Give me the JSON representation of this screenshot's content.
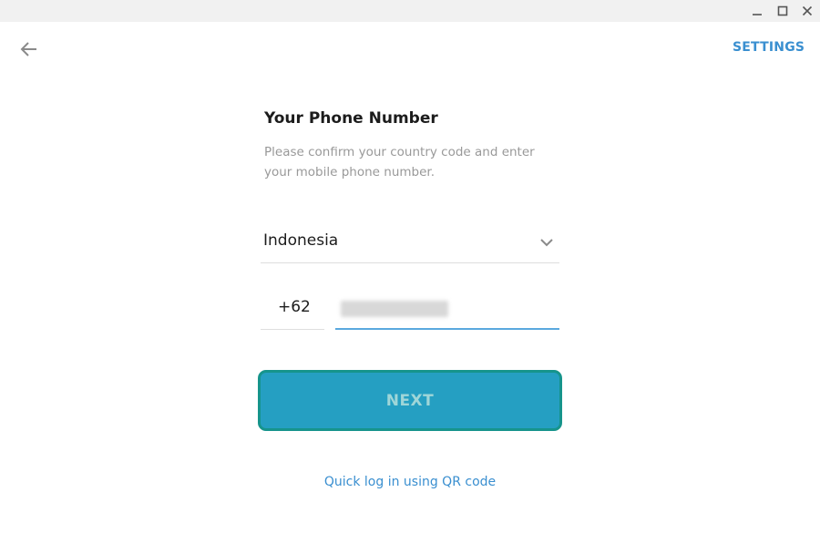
{
  "window": {
    "minimize_icon": "minimize-icon",
    "maximize_icon": "maximize-icon",
    "close_icon": "close-icon"
  },
  "header": {
    "back_icon": "arrow-left-icon",
    "settings_label": "SETTINGS"
  },
  "login": {
    "title": "Your Phone Number",
    "subtitle": "Please confirm your country code and enter your mobile phone number.",
    "country": "Indonesia",
    "country_code": "+62",
    "phone_value_redacted": true,
    "next_label": "NEXT",
    "qr_link_label": "Quick log in using QR code"
  },
  "colors": {
    "accent_link": "#3a8fd0",
    "button_bg": "#259fc2",
    "button_border": "#16948c",
    "button_text": "#9fd6d8",
    "active_underline": "#5aa9de"
  }
}
